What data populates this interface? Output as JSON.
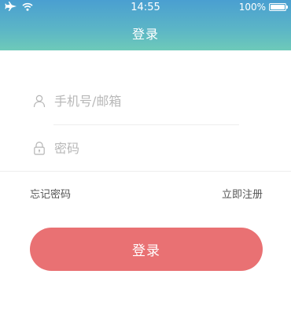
{
  "status_bar": {
    "time": "14:55",
    "battery_text": "100%",
    "battery_level": 1.0
  },
  "nav": {
    "title": "登录"
  },
  "form": {
    "phone_placeholder": "手机号/邮箱",
    "phone_value": "",
    "password_placeholder": "密码",
    "password_value": ""
  },
  "links": {
    "forgot": "忘记密码",
    "register": "立即注册"
  },
  "login_button": {
    "label": "登录"
  },
  "colors": {
    "header_top": "#4a9fd1",
    "header_bottom": "#6ecab9",
    "button": "#e97173",
    "placeholder": "#b8b8b8",
    "divider": "#eeeeee"
  },
  "icons": {
    "status": [
      "airplane-icon",
      "wifi-icon",
      "battery-icon"
    ],
    "fields": [
      "user-icon",
      "lock-icon"
    ]
  }
}
